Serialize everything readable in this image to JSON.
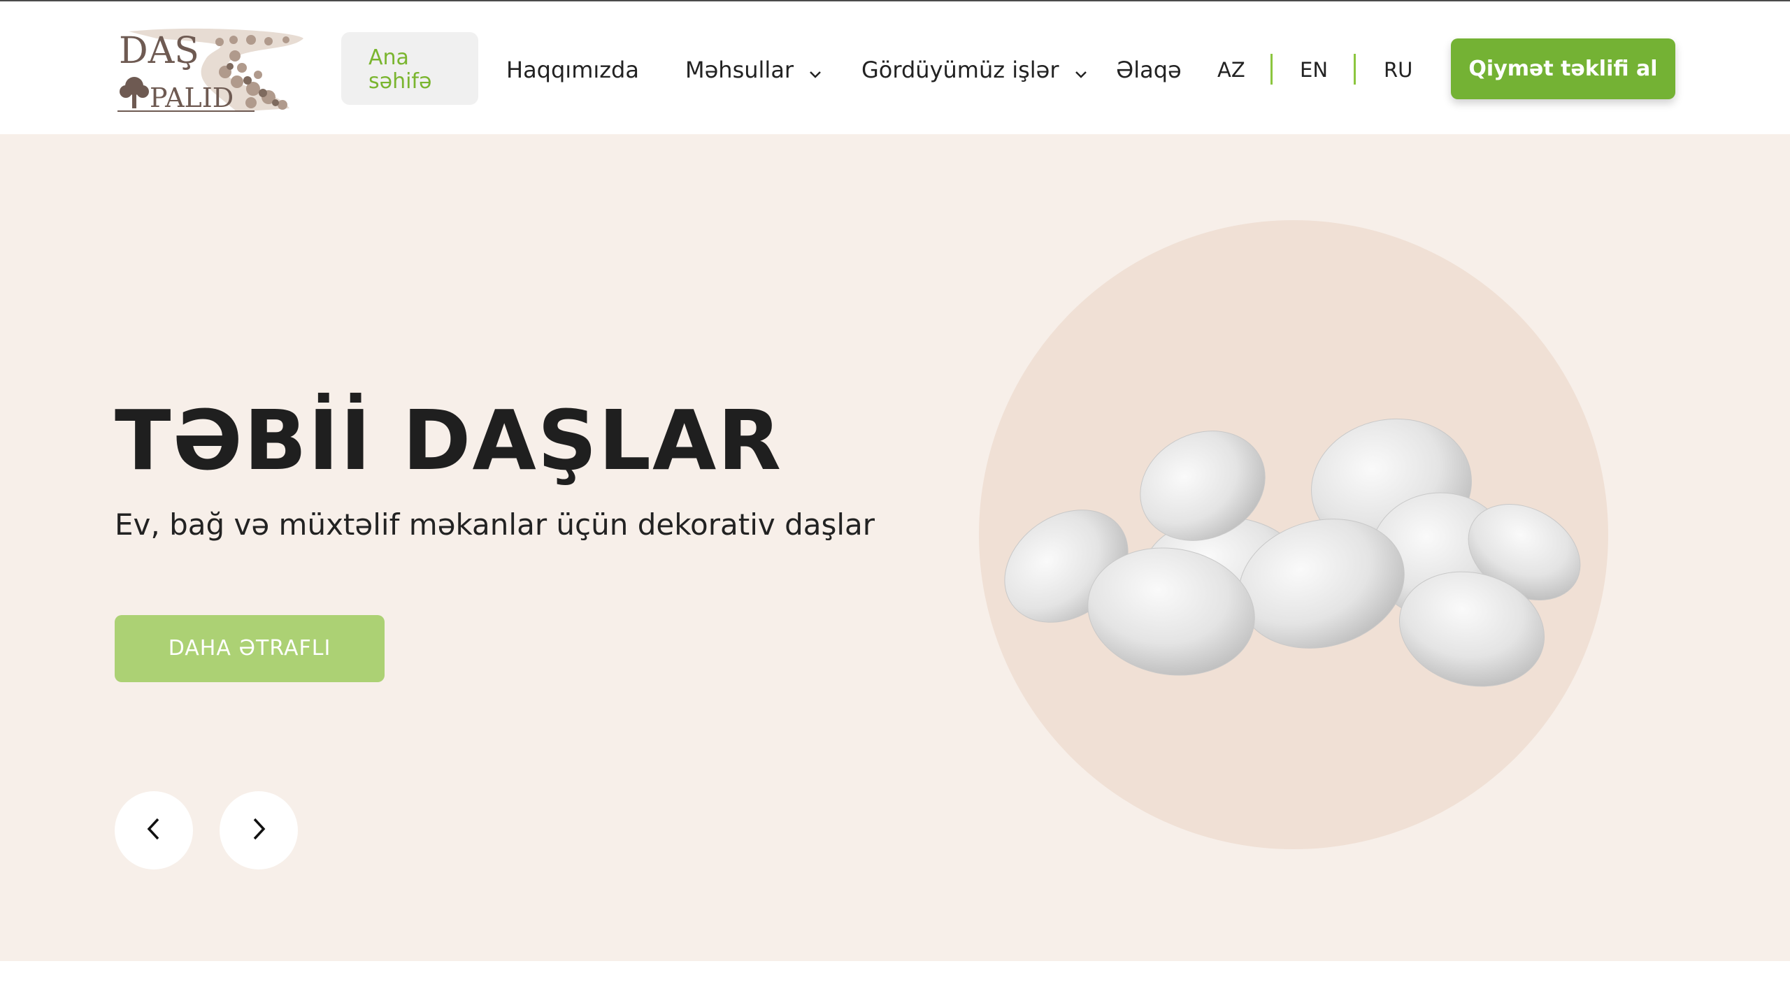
{
  "header": {
    "logo": {
      "line1": "DAŞ",
      "line2": "PALID",
      "brand_colors": [
        "#6e5a52",
        "#a58c7d"
      ]
    },
    "nav": {
      "home": "Ana səhifə",
      "about": "Haqqımızda",
      "products": "Məhsullar",
      "works": "Gördüyümüz işlər",
      "contact": "Əlaqə"
    },
    "languages": [
      "AZ",
      "EN",
      "RU"
    ],
    "quote_button": "Qiymət təklifi al"
  },
  "hero": {
    "title": "TƏBİİ DAŞLAR",
    "subtitle": "Ev, bağ və müxtəlif məkanlar üçün dekorativ daşlar",
    "more_button": "DAHA ƏTRAFLI",
    "prev_icon": "chevron-left-icon",
    "next_icon": "chevron-right-icon",
    "image": "white-pebble-stones"
  },
  "colors": {
    "accent_green": "#74b234",
    "light_green": "#acd174",
    "nav_active": "#7ab52f",
    "hero_bg": "#f7efe9",
    "circle_bg": "#f0e0d5"
  }
}
